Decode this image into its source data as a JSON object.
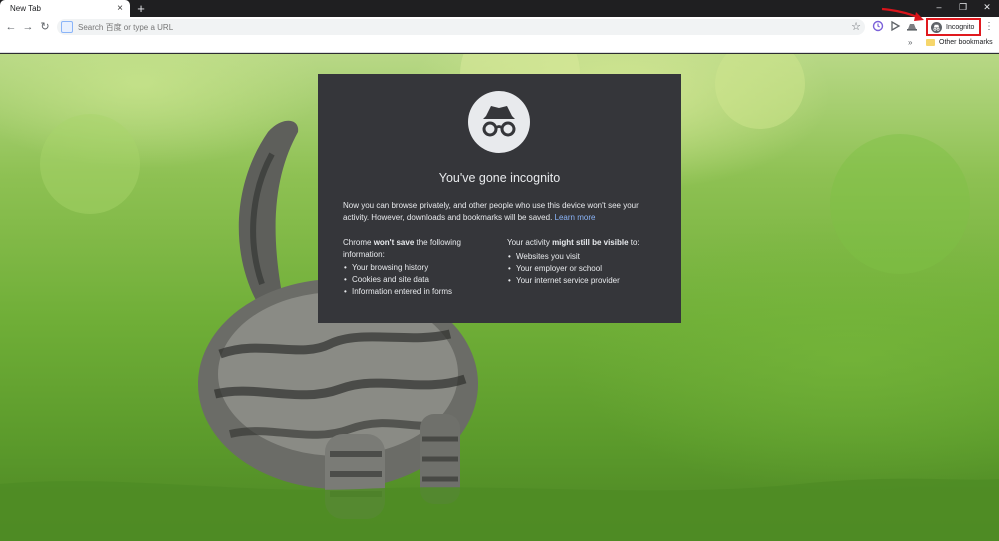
{
  "window": {
    "tab_title": "New Tab",
    "tab_close_icon": "×",
    "new_tab_icon": "+",
    "controls": {
      "minimize": "–",
      "restore": "❐",
      "close": "✕"
    }
  },
  "toolbar": {
    "back_icon": "←",
    "forward_icon": "→",
    "reload_icon": "↻",
    "omnibox_placeholder": "Search 百度 or type a URL",
    "star_icon": "☆",
    "incognito_label": "Incognito",
    "menu_icon": "⋮"
  },
  "bookmarks": {
    "overflow_icon": "»",
    "other_bookmarks": "Other bookmarks"
  },
  "incognito_page": {
    "title": "You've gone incognito",
    "description": "Now you can browse privately, and other people who use this device won't see your activity. However, downloads and bookmarks will be saved.",
    "learn_more": "Learn more",
    "left": {
      "prefix": "Chrome ",
      "bold": "won't save",
      "suffix": " the following information:",
      "items": [
        "Your browsing history",
        "Cookies and site data",
        "Information entered in forms"
      ]
    },
    "right": {
      "prefix": "Your activity ",
      "bold": "might still be visible",
      "suffix": " to:",
      "items": [
        "Websites you visit",
        "Your employer or school",
        "Your internet service provider"
      ]
    }
  },
  "colors": {
    "card_bg": "#35363a",
    "link": "#8ab4f8",
    "highlight_border": "#e0191e"
  }
}
